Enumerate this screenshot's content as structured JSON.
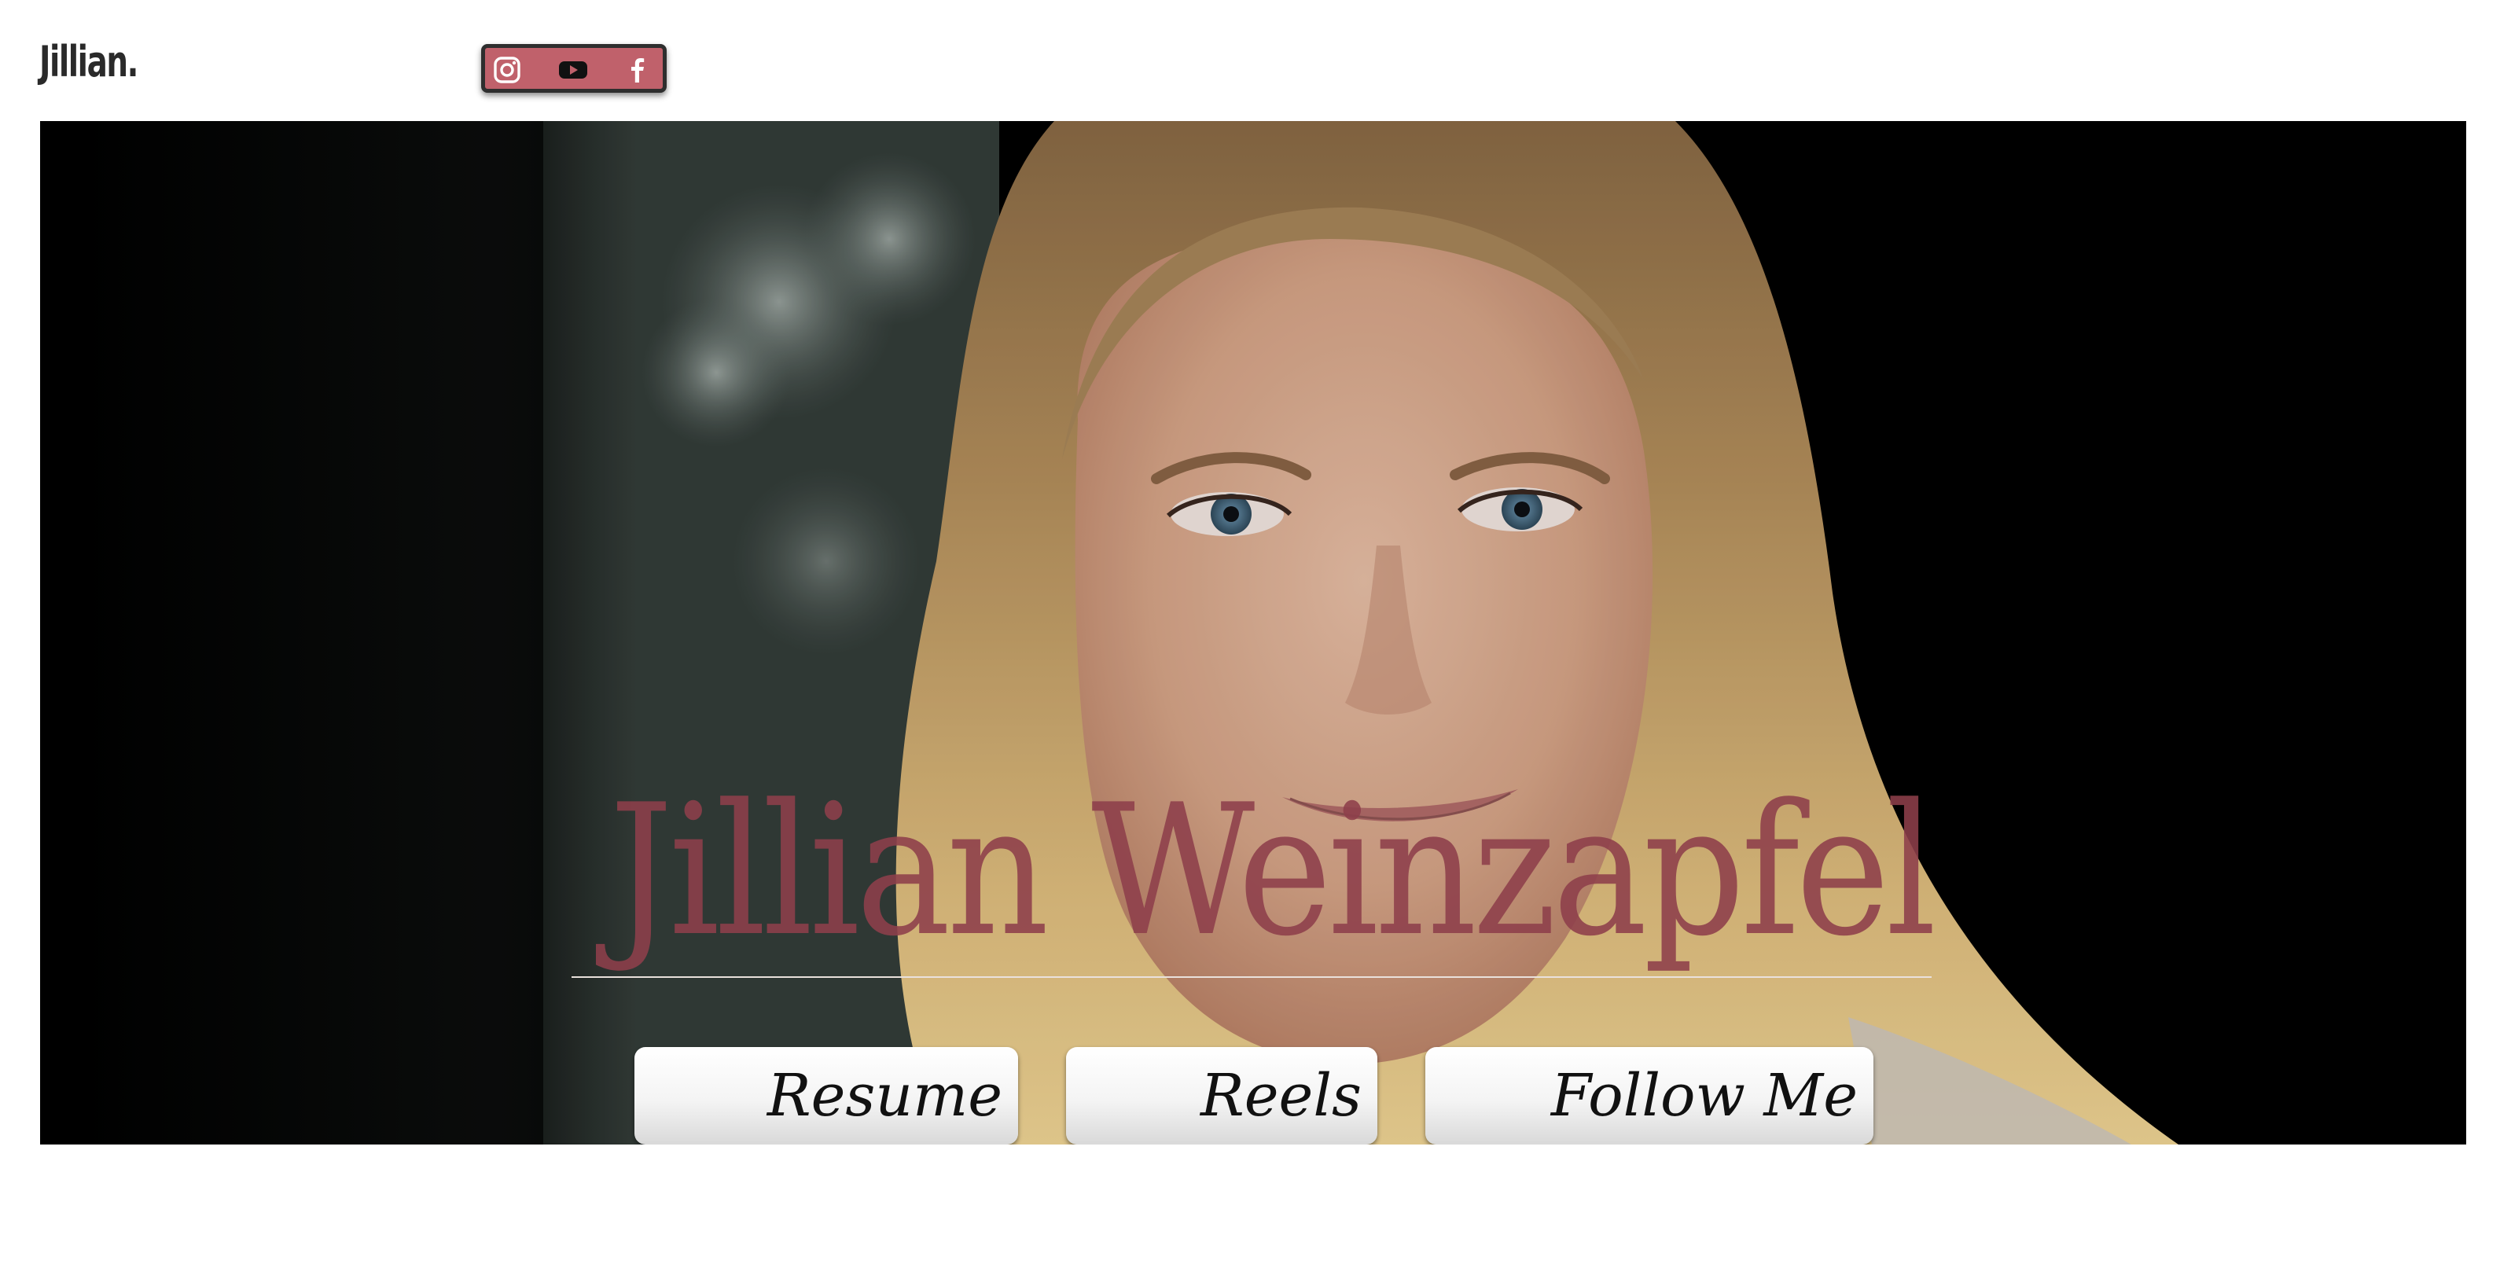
{
  "header": {
    "logo_text": "Jillian.",
    "social_icons": [
      "instagram-icon",
      "youtube-icon",
      "facebook-icon"
    ],
    "social_bar_color": "#c0616b"
  },
  "hero": {
    "name": "Jillian Weinzapfel",
    "name_color": "#8e3f4b",
    "buttons": [
      {
        "label": "Resume"
      },
      {
        "label": "Reels"
      },
      {
        "label": "Follow Me"
      }
    ]
  }
}
